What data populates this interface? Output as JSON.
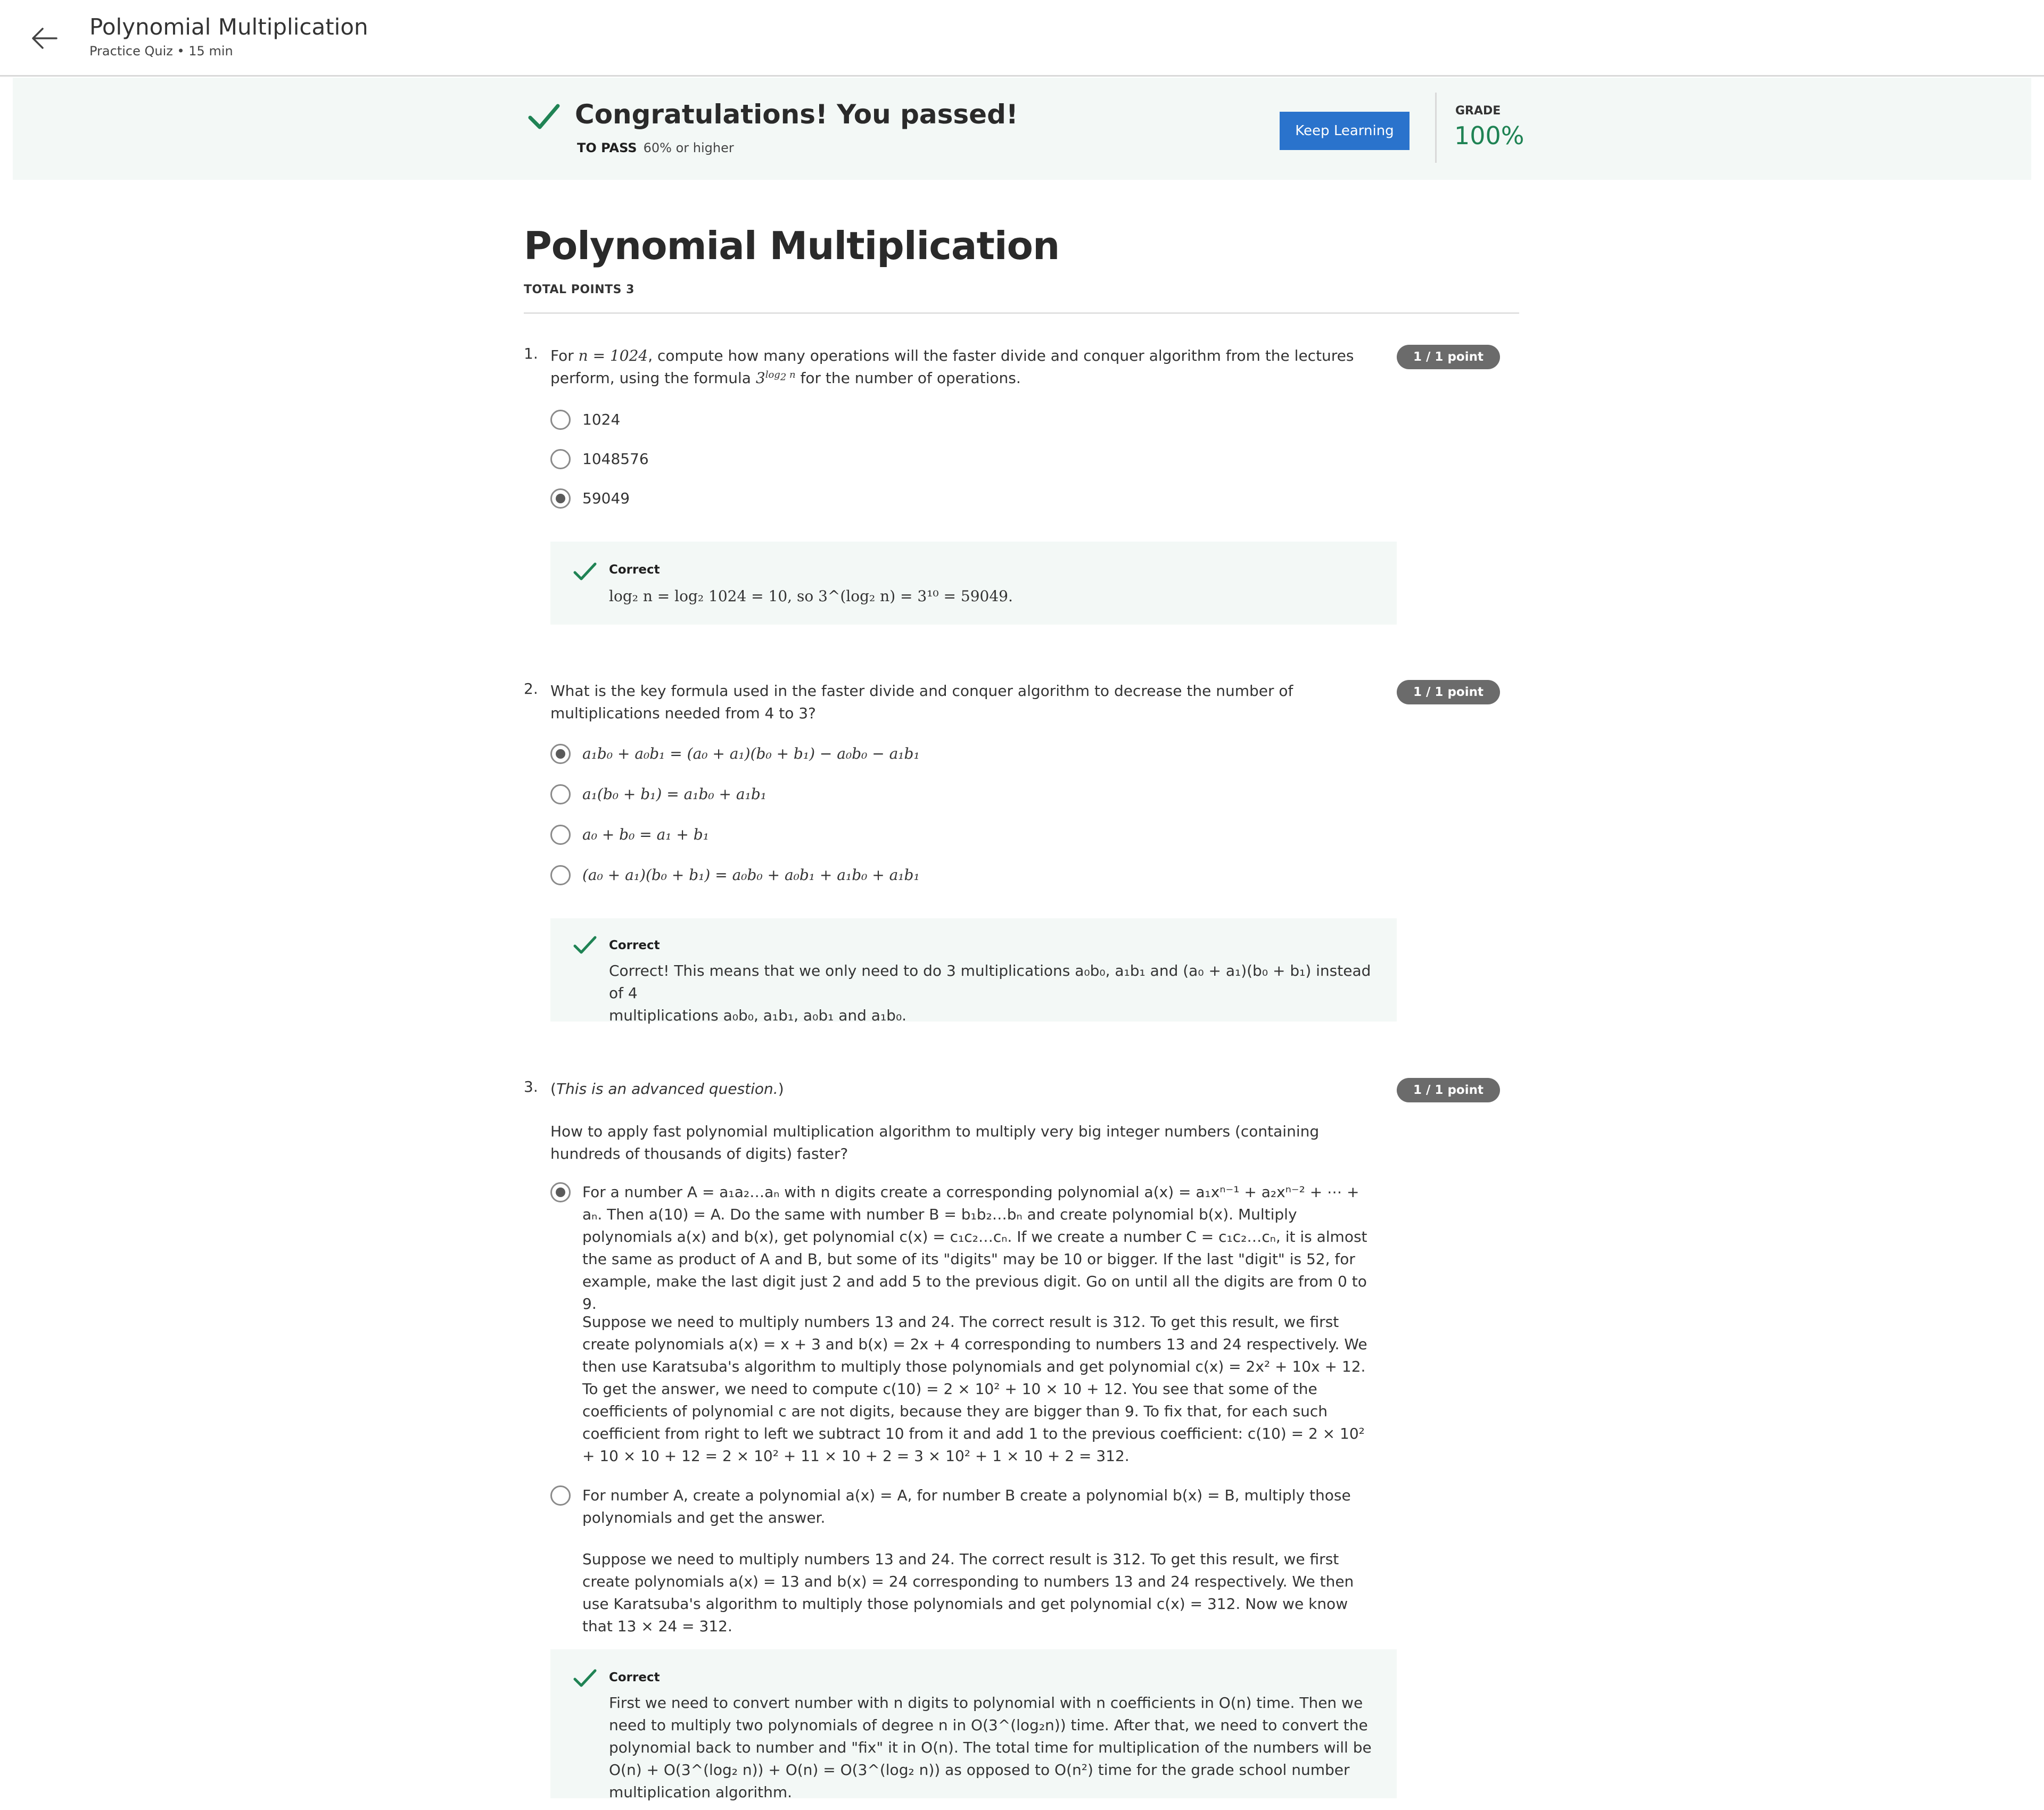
{
  "header": {
    "title": "Polynomial Multiplication",
    "subtitle": "Practice Quiz • 15 min"
  },
  "banner": {
    "title": "Congratulations! You passed!",
    "to_pass_label": "TO PASS",
    "to_pass_value": "60% or higher",
    "keep_button": "Keep Learning",
    "grade_label": "GRADE",
    "grade_value": "100%",
    "accent_color": "#1f8354",
    "button_color": "#2a73cc"
  },
  "quiz": {
    "title": "Polynomial Multiplication",
    "total_points": "TOTAL POINTS 3"
  },
  "questions": [
    {
      "number": "1.",
      "badge": "1 / 1 point",
      "text_a": "For ",
      "text_b": "n = 1024",
      "text_c": ", compute how many operations will the faster divide and conquer algorithm from the lectures perform, using the formula ",
      "text_d": " for the number of operations.",
      "options": [
        "1024",
        "1048576",
        "59049"
      ],
      "selected": 2,
      "feedback_label": "Correct",
      "feedback": "log₂ n = log₂ 1024 = 10, so 3^(log₂ n) = 3¹⁰ = 59049."
    },
    {
      "number": "2.",
      "badge": "1 / 1 point",
      "text": "What is the key formula used in the faster divide and conquer algorithm to decrease the number of multiplications needed from 4 to 3?",
      "options": [
        "a₁b₀ + a₀b₁ = (a₀ + a₁)(b₀ + b₁) − a₀b₀ − a₁b₁",
        "a₁(b₀ + b₁) = a₁b₀ + a₁b₁",
        "a₀ + b₀ = a₁ + b₁",
        "(a₀ + a₁)(b₀ + b₁) = a₀b₀ + a₀b₁ + a₁b₀ + a₁b₁"
      ],
      "selected": 0,
      "feedback_label": "Correct",
      "feedback_line1": "Correct! This means that we only need to do 3 multiplications a₀b₀, a₁b₁ and (a₀ + a₁)(b₀ + b₁) instead of 4",
      "feedback_line2": "multiplications a₀b₀, a₁b₁, a₀b₁ and a₁b₀."
    },
    {
      "number": "3.",
      "badge": "1 / 1 point",
      "note": "This is an advanced question.",
      "text": "How to apply fast polynomial multiplication algorithm to multiply very big integer numbers (containing hundreds of thousands of digits) faster?",
      "option1_p1": "For a number A = a₁a₂…aₙ with n digits create a corresponding polynomial a(x) = a₁xⁿ⁻¹ + a₂xⁿ⁻² + ⋯ + aₙ. Then a(10) = A. Do the same with number B = b₁b₂…bₙ and create polynomial b(x). Multiply polynomials a(x) and b(x), get polynomial c(x) = c₁c₂…cₙ. If we create a number C = c₁c₂…cₙ, it is almost the same as product of A and B, but some of its \"digits\" may be 10 or bigger. If the last \"digit\" is 52, for example, make the last digit just 2 and add 5 to the previous digit. Go on until all the digits are from 0 to 9.",
      "option1_p2": "Suppose we need to multiply numbers 13 and 24. The correct result is 312. To get this result, we first create polynomials a(x) = x + 3 and b(x) = 2x + 4 corresponding to numbers 13 and 24 respectively. We then use Karatsuba's algorithm to multiply those polynomials and get polynomial c(x) = 2x² + 10x + 12. To get the answer, we need to compute c(10) = 2 × 10² + 10 × 10 + 12. You see that some of the coefficients of polynomial c are not digits, because they are bigger than 9. To fix that, for each such coefficient from right to left we subtract 10 from it and add 1 to the previous coefficient: c(10) = 2 × 10² + 10 × 10 + 12 = 2 × 10² + 11 × 10 + 2 = 3 × 10² + 1 × 10 + 2 = 312.",
      "option2_p1": "For number A, create a polynomial a(x) = A, for number B create a polynomial b(x) = B, multiply those polynomials and get the answer.",
      "option2_p2": "Suppose we need to multiply numbers 13 and 24. The correct result is 312. To get this result, we first create polynomials a(x) = 13 and b(x) = 24 corresponding to numbers 13 and 24 respectively. We then use Karatsuba's algorithm to multiply those polynomials and get polynomial c(x) = 312. Now we know that 13 × 24 = 312.",
      "selected": 0,
      "feedback_label": "Correct",
      "feedback": "First we need to convert number with n digits to polynomial with n coefficients in O(n) time. Then we need to multiply two polynomials of degree n in O(3^(log₂n)) time. After that, we need to convert the polynomial back to number and \"fix\" it in O(n). The total time for multiplication of the numbers will be O(n) + O(3^(log₂ n)) + O(n) = O(3^(log₂ n)) as opposed to O(n²) time for the grade school number multiplication algorithm."
    }
  ]
}
